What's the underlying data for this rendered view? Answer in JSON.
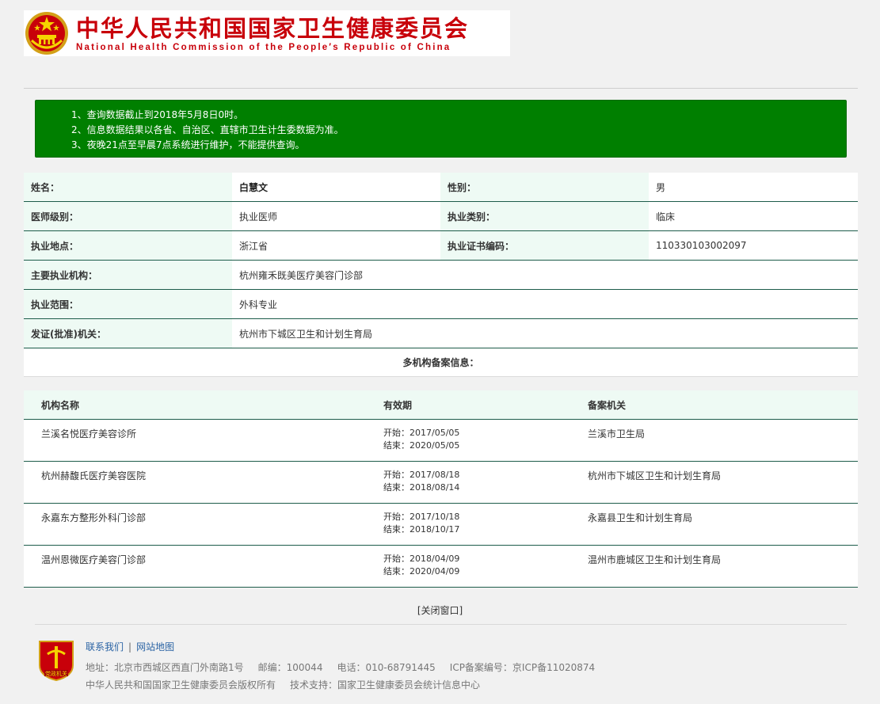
{
  "header": {
    "cn_title": "中华人民共和国国家卫生健康委员会",
    "en_title": "National Health Commission of the People′s Republic of China"
  },
  "notice": [
    "1、查询数据截止到2018年5月8日0时。",
    "2、信息数据结果以各省、自治区、直辖市卫生计生委数据为准。",
    "3、夜晚21点至早晨7点系统进行维护，不能提供查询。"
  ],
  "info": {
    "name_label": "姓名：",
    "name_value": "白慧文",
    "gender_label": "性别：",
    "gender_value": "男",
    "level_label": "医师级别：",
    "level_value": "执业医师",
    "category_label": "执业类别：",
    "category_value": "临床",
    "location_label": "执业地点：",
    "location_value": "浙江省",
    "cert_label": "执业证书编码：",
    "cert_value": "110330103002097",
    "org_label": "主要执业机构：",
    "org_value": "杭州雍禾既美医疗美容门诊部",
    "scope_label": "执业范围：",
    "scope_value": "外科专业",
    "issuer_label": "发证(批准)机关：",
    "issuer_value": "杭州市下城区卫生和计划生育局"
  },
  "multi_title": "多机构备案信息：",
  "org_table": {
    "headers": [
      "机构名称",
      "有效期",
      "备案机关"
    ],
    "rows": [
      {
        "name": "兰溪名悦医疗美容诊所",
        "start": "开始：2017/05/05",
        "end": "结束：2020/05/05",
        "authority": "兰溪市卫生局"
      },
      {
        "name": "杭州赫馥氏医疗美容医院",
        "start": "开始：2017/08/18",
        "end": "结束：2018/08/14",
        "authority": "杭州市下城区卫生和计划生育局"
      },
      {
        "name": "永嘉东方整形外科门诊部",
        "start": "开始：2017/10/18",
        "end": "结束：2018/10/17",
        "authority": "永嘉县卫生和计划生育局"
      },
      {
        "name": "温州恩微医疗美容门诊部",
        "start": "开始：2018/04/09",
        "end": "结束：2020/04/09",
        "authority": "温州市鹿城区卫生和计划生育局"
      }
    ]
  },
  "close_label": "[关闭窗口]",
  "footer": {
    "contact": "联系我们",
    "sep": "|",
    "sitemap": "网站地图",
    "address": "地址：北京市西城区西直门外南路1号",
    "postcode": "邮编：100044",
    "phone": "电话：010-68791445",
    "icp": "ICP备案编号：京ICP备11020874",
    "copyright": "中华人民共和国国家卫生健康委员会版权所有",
    "support": "技术支持：国家卫生健康委员会统计信息中心",
    "logo_text": "党政机关"
  },
  "colors": {
    "brand_red": "#c8000a",
    "notice_green": "#007f00",
    "row_border": "#1d5c4a",
    "label_bg": "#eefaf4"
  }
}
